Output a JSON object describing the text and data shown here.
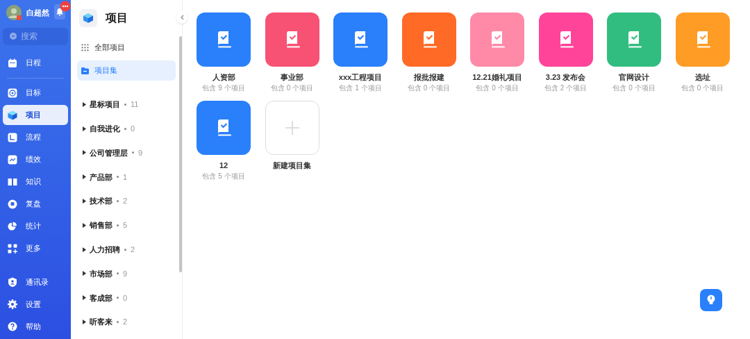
{
  "user": {
    "name": "白超然"
  },
  "search": {
    "placeholder": "搜索"
  },
  "nav": [
    {
      "label": "日程",
      "selected": false
    },
    {
      "label": "目标",
      "selected": false
    },
    {
      "label": "项目",
      "selected": true
    },
    {
      "label": "流程",
      "selected": false
    },
    {
      "label": "绩效",
      "selected": false
    },
    {
      "label": "知识",
      "selected": false
    },
    {
      "label": "复盘",
      "selected": false
    },
    {
      "label": "统计",
      "selected": false
    },
    {
      "label": "更多",
      "selected": false
    }
  ],
  "nav_bottom": [
    {
      "label": "通讯录"
    },
    {
      "label": "设置"
    },
    {
      "label": "帮助"
    }
  ],
  "panel": {
    "title": "项目",
    "views": [
      {
        "label": "全部项目",
        "selected": false
      },
      {
        "label": "项目集",
        "selected": true
      }
    ],
    "groups": [
      {
        "label": "星标项目",
        "count": "11"
      },
      {
        "label": "自我进化",
        "count": "0"
      },
      {
        "label": "公司管理层",
        "count": "9"
      },
      {
        "label": "产品部",
        "count": "1"
      },
      {
        "label": "技术部",
        "count": "2"
      },
      {
        "label": "销售部",
        "count": "5"
      },
      {
        "label": "人力招聘",
        "count": "2"
      },
      {
        "label": "市场部",
        "count": "9"
      },
      {
        "label": "客成部",
        "count": "0"
      },
      {
        "label": "听客来",
        "count": "2"
      }
    ]
  },
  "collections": [
    {
      "kind": "collection",
      "name": "人资部",
      "info": "包含 9 个项目",
      "color": "#2a7ffa"
    },
    {
      "kind": "collection",
      "name": "事业部",
      "info": "包含 0 个项目",
      "color": "#f75273"
    },
    {
      "kind": "collection",
      "name": "xxx工程项目",
      "info": "包含 1 个项目",
      "color": "#2a7ffa"
    },
    {
      "kind": "collection",
      "name": "报批报建",
      "info": "包含 0 个项目",
      "color": "#ff6a26"
    },
    {
      "kind": "collection",
      "name": "12.21婚礼项目",
      "info": "包含 0 个项目",
      "color": "#ff8aa8"
    },
    {
      "kind": "collection",
      "name": "3.23 发布会",
      "info": "包含 2 个项目",
      "color": "#ff4499"
    },
    {
      "kind": "collection",
      "name": "官网设计",
      "info": "包含 0 个项目",
      "color": "#32bd80"
    },
    {
      "kind": "collection",
      "name": "选址",
      "info": "包含 0 个项目",
      "color": "#ff9c26"
    },
    {
      "kind": "collection",
      "name": "12",
      "info": "包含 5 个项目",
      "color": "#2a7ffa"
    },
    {
      "kind": "new",
      "name": "新建项目集"
    }
  ]
}
